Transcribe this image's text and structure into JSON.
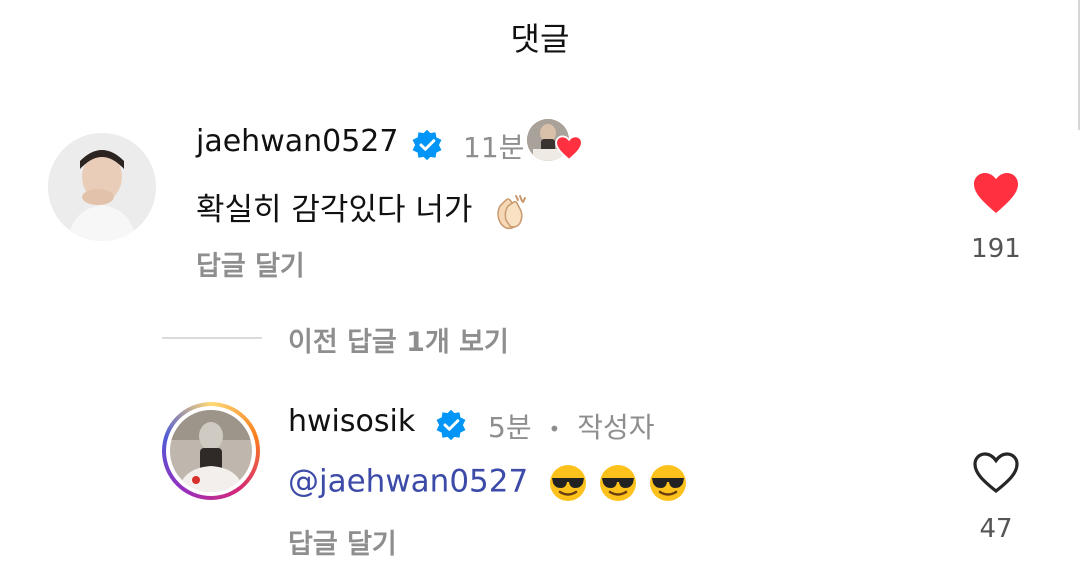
{
  "header": {
    "title": "댓글"
  },
  "comments": [
    {
      "username": "jaehwan0527",
      "verified": true,
      "time": "11분",
      "text": "확실히 감각있다 너가",
      "emoji": "clapping-hands",
      "reply_label": "답글 달기",
      "likes": "191",
      "liked": true,
      "creator_liked": true
    }
  ],
  "thread": {
    "view_previous_label": "이전 답글 1개 보기"
  },
  "replies": [
    {
      "username": "hwisosik",
      "verified": true,
      "time": "5분",
      "separator": "•",
      "author_label": "작성자",
      "mention": "@jaehwan0527",
      "emoji": [
        "smiling-face-with-sunglasses",
        "smiling-face-with-sunglasses",
        "smiling-face-with-sunglasses"
      ],
      "reply_label": "답글 달기",
      "likes": "47",
      "liked": false,
      "has_story_ring": true
    }
  ],
  "colors": {
    "like_red": "#ff3040",
    "verified_blue": "#0095f6",
    "mention": "#3d4ba8",
    "muted": "#8e8e8e"
  }
}
